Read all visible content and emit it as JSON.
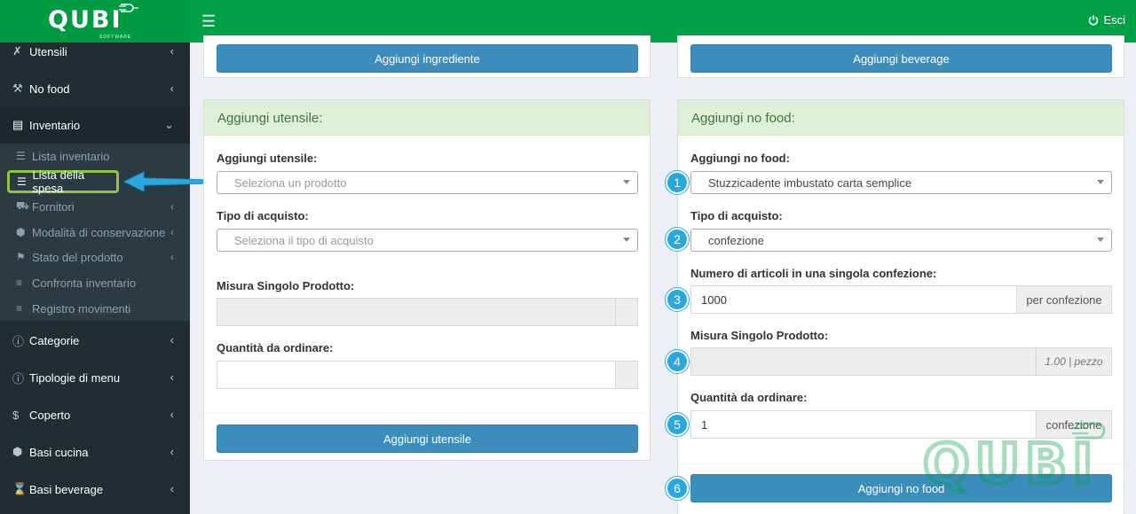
{
  "header": {
    "logo": "QUBI",
    "logo_sub": "SOFTWARE",
    "logout_label": "Esci",
    "menu_icon": "bars-icon",
    "logout_icon": "power-icon"
  },
  "sidebar": {
    "items": [
      {
        "label": "Utensili",
        "icon": "cutlery-icon"
      },
      {
        "label": "No food",
        "icon": "wrench-icon"
      },
      {
        "label": "Inventario",
        "icon": "table-icon"
      },
      {
        "label": "Categorie",
        "icon": "info-circle-icon"
      },
      {
        "label": "Tipologie di menu",
        "icon": "info-circle-icon"
      },
      {
        "label": "Coperto",
        "icon": "dollar-icon"
      },
      {
        "label": "Basi cucina",
        "icon": "cube-icon"
      },
      {
        "label": "Basi beverage",
        "icon": "hourglass-icon"
      }
    ],
    "sub_items": [
      {
        "label": "Lista inventario",
        "icon": "list-icon"
      },
      {
        "label": "Lista della spesa",
        "icon": "list-icon"
      },
      {
        "label": "Fornitori",
        "icon": "truck-icon"
      },
      {
        "label": "Modalità di conservazione",
        "icon": "cube-icon"
      },
      {
        "label": "Stato del prodotto",
        "icon": "flag-icon"
      },
      {
        "label": "Confronta inventario",
        "icon": "bars-icon"
      },
      {
        "label": "Registro movimenti",
        "icon": "bars-icon"
      }
    ]
  },
  "top_buttons": {
    "left": "Aggiungi ingrediente",
    "right": "Aggiungi beverage"
  },
  "left_panel": {
    "title": "Aggiungi utensile:",
    "field1_label": "Aggiungi utensile:",
    "field1_placeholder": "Seleziona un prodotto",
    "field2_label": "Tipo di acquisto:",
    "field2_placeholder": "Seleziona il tipo di acquisto",
    "field3_label": "Misura Singolo Prodotto:",
    "field4_label": "Quantità da ordinare:",
    "submit": "Aggiungi utensile"
  },
  "right_panel": {
    "title": "Aggiungi no food:",
    "field1_label": "Aggiungi no food:",
    "field1_value": "Stuzzicadente imbustato carta semplice",
    "field2_label": "Tipo di acquisto:",
    "field2_value": "confezione",
    "field3_label": "Numero di articoli in una singola confezione:",
    "field3_value": "1000",
    "field3_addon": "per confezione",
    "field4_label": "Misura Singolo Prodotto:",
    "field4_addon": "1.00 | pezzo",
    "field5_label": "Quantità da ordinare:",
    "field5_value": "1",
    "field5_addon": "confezione",
    "submit": "Aggiungi no food"
  },
  "steps": [
    "1",
    "2",
    "3",
    "4",
    "5",
    "6"
  ],
  "colors": {
    "header": "#00a046",
    "sidebar": "#222d32",
    "primary": "#3c8dbc",
    "panel_head": "#dff0d8",
    "step": "#29a8e0",
    "highlight": "#8dc63f"
  }
}
